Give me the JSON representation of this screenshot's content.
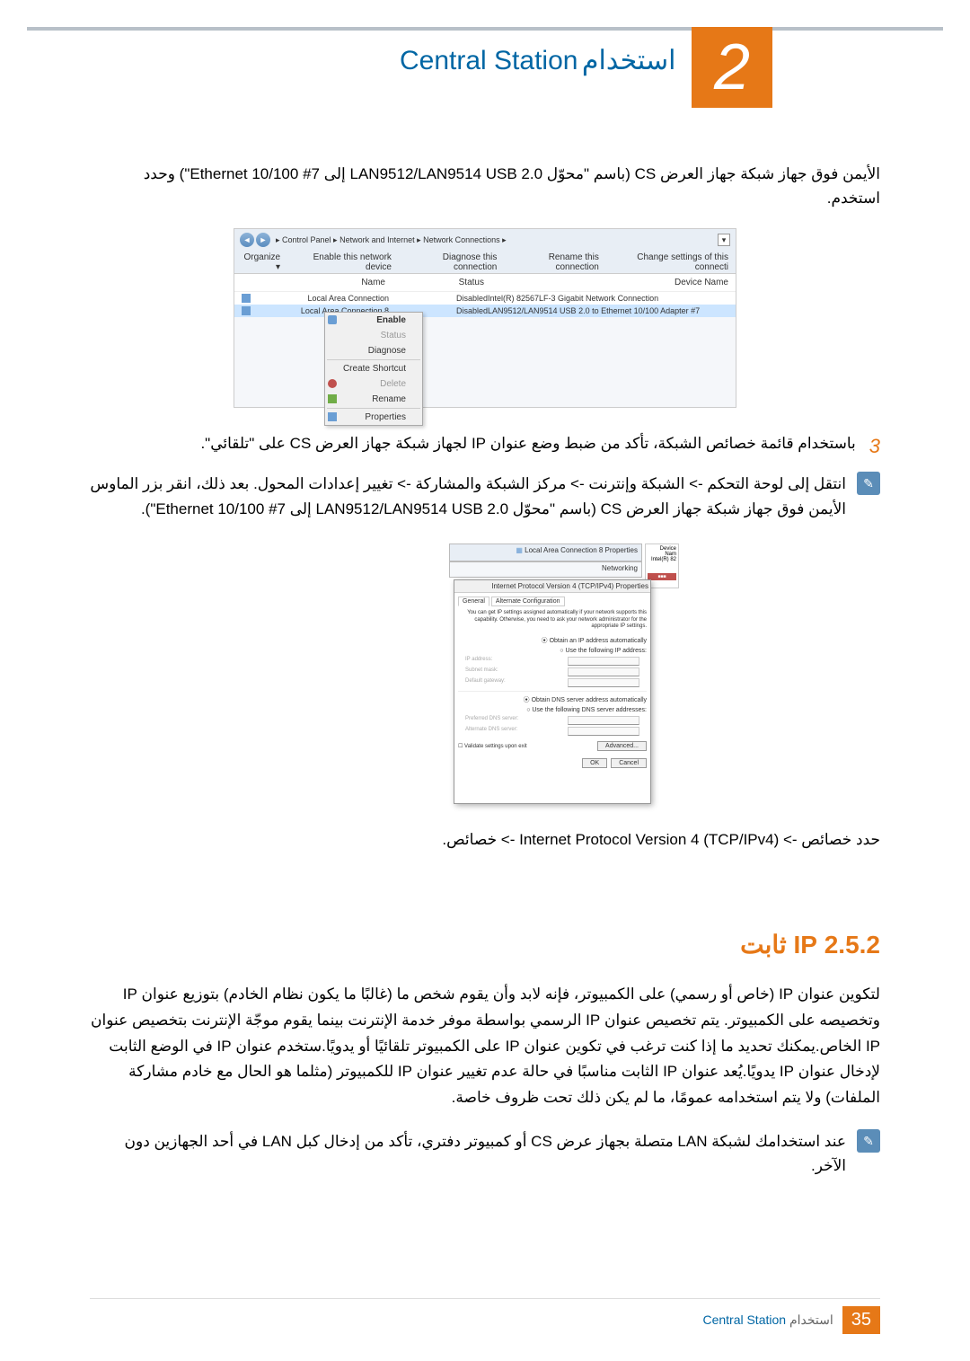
{
  "chapter": {
    "number": "2",
    "title_ar": "استخدام",
    "title_en": "Central Station"
  },
  "para1": "الأيمن فوق جهاز شبكة جهاز العرض CS (باسم \"محوّل LAN9512/LAN9514 USB 2.0 إلى Ethernet 10/100 #7\") وحدد استخدم.",
  "screenshot1": {
    "breadcrumb": "▸ Control Panel ▸ Network and Internet ▸ Network Connections ▸",
    "toolbar": [
      "Organize ▾",
      "Enable this network device",
      "Diagnose this connection",
      "Rename this connection",
      "Change settings of this connecti"
    ],
    "columns": [
      "Name",
      "Status",
      "Device Name"
    ],
    "rows": [
      {
        "name": "Local Area Connection",
        "status": "Disabled",
        "device": "Intel(R) 82567LF-3 Gigabit Network Connection"
      },
      {
        "name": "Local Area Connection 8",
        "status": "Disabled",
        "device": "LAN9512/LAN9514 USB 2.0 to Ethernet 10/100 Adapter #7"
      }
    ],
    "context_menu": [
      "Enable",
      "Status",
      "Diagnose",
      "Create Shortcut",
      "Delete",
      "Rename",
      "Properties"
    ]
  },
  "step3": {
    "number": "3",
    "text": "باستخدام قائمة خصائص الشبكة، تأكد من ضبط وضع عنوان IP لجهاز شبكة جهاز العرض CS على \"تلقائي\"."
  },
  "note1": "انتقل إلى لوحة التحكم -> الشبكة وإنترنت -> مركز الشبكة والمشاركة -> تغيير إعدادات المحول. بعد ذلك، انقر بزر الماوس الأيمن فوق جهاز شبكة جهاز العرض CS (باسم \"محوّل LAN9512/LAN9514 USB 2.0 إلى Ethernet 10/100 #7\").",
  "screenshot2": {
    "props_title": "Local Area Connection 8 Properties",
    "networking_tab": "Networking",
    "ipv4_title": "Internet Protocol Version 4 (TCP/IPv4) Properties",
    "tabs": [
      "General",
      "Alternate Configuration"
    ],
    "desc": "You can get IP settings assigned automatically if your network supports this capability. Otherwise, you need to ask your network administrator for the appropriate IP settings.",
    "radio_auto_ip": "Obtain an IP address automatically",
    "radio_manual_ip": "Use the following IP address:",
    "ip_address": "IP address:",
    "subnet": "Subnet mask:",
    "gateway": "Default gateway:",
    "radio_auto_dns": "Obtain DNS server address automatically",
    "radio_manual_dns": "Use the following DNS server addresses:",
    "pref_dns": "Preferred DNS server:",
    "alt_dns": "Alternate DNS server:",
    "validate": "Validate settings upon exit",
    "advanced": "Advanced...",
    "ok": "OK",
    "cancel": "Cancel",
    "device_name": "Device Nam",
    "intel": "Intel(R) 82"
  },
  "para_select": "حدد خصائص -> Internet Protocol Version 4 (TCP/IPv4) -> خصائص.",
  "section": {
    "heading": "2.5.2 IP ثابت",
    "body": "لتكوين عنوان IP (خاص أو رسمي) على الكمبيوتر، فإنه لابد وأن يقوم شخص ما (غالبًا ما يكون نظام الخادم) بتوزيع عنوان IP وتخصيصه على الكمبيوتر. يتم تخصيص عنوان IP الرسمي بواسطة موفر خدمة الإنترنت بينما يقوم موجّة الإنترنت بتخصيص عنوان IP الخاص.يمكنك تحديد ما إذا كنت ترغب في تكوين عنوان IP على الكمبيوتر تلقائيًا أو يدويًا.ستخدم عنوان IP في الوضع الثابت لإدخال عنوان IP يدويًا.يُعد عنوان IP الثابت مناسبًا في حالة عدم تغيير عنوان IP للكمبيوتر (مثلما هو الحال مع خادم مشاركة الملفات) ولا يتم استخدامه عمومًا، ما لم يكن ذلك تحت ظروف خاصة."
  },
  "note2": "عند استخدامك لشبكة LAN متصلة بجهاز عرض CS أو كمبيوتر دفتري، تأكد من إدخال كبل LAN في أحد الجهازين دون الآخر.",
  "footer": {
    "page": "35",
    "text_ar": "استخدام",
    "text_en": "Central Station"
  }
}
